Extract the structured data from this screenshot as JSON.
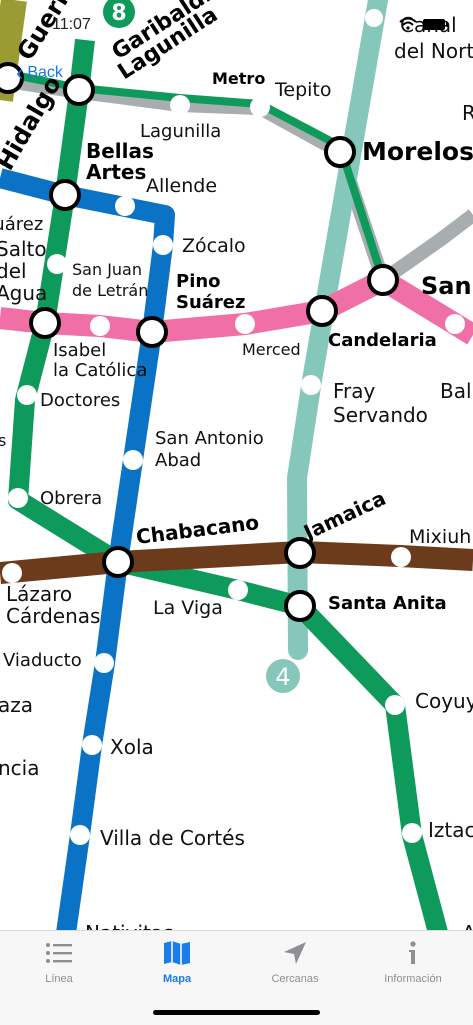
{
  "status_bar": {
    "time": "11:07",
    "back_label": "Back"
  },
  "line_badges": {
    "line8": "8",
    "line4": "4"
  },
  "stations": {
    "guerrero": "Guerrero",
    "garibaldi": "Garibaldi",
    "lagunilla_top": "Lagunilla",
    "hidalgo": "Hidalgo",
    "bellas": "Bellas",
    "artes": "Artes",
    "allende": "Allende",
    "metro": "Metro",
    "tepito": "Tepito",
    "lagunilla": "Lagunilla",
    "morelos": "Morelos",
    "canal": "Canal",
    "del_norte": "del Norte",
    "r": "R",
    "juarez": "Juárez",
    "salto": "Salto",
    "del": "del",
    "agua": "Agua",
    "san_juan": "San Juan",
    "de_letran": "de Letrán",
    "zocalo": "Zócalo",
    "pino": "Pino",
    "suarez": "Suárez",
    "san": "San",
    "candelaria": "Candelaria",
    "merced": "Merced",
    "isabel": "Isabel",
    "la_catolica": "la Católica",
    "fray": "Fray",
    "servando": "Servando",
    "bal": "Bal",
    "doctores": "Doctores",
    "s": "s",
    "san_antonio": "San Antonio",
    "abad": "Abad",
    "obrera": "Obrera",
    "chabacano": "Chabacano",
    "jamaica": "Jamaica",
    "mixiuhca": "Mixiuh",
    "lazaro": "Lázaro",
    "cardenas": "Cárdenas",
    "la_viga": "La Viga",
    "santa_anita": "Santa Anita",
    "viaducto": "Viaducto",
    "coyuya": "Coyuy",
    "aza": "aza",
    "xola": "Xola",
    "ncia": "ncia",
    "iztacalco": "Iztac",
    "villa_de_cortes": "Villa de Cortés",
    "nativitas": "Nativitas",
    "a": "A"
  },
  "colors": {
    "line1": "#f06fa6",
    "line2": "#0b73c5",
    "line4": "#86c7bb",
    "line8": "#0d9a5a",
    "line9": "#6b3b1c",
    "lineB": "#a8adb0",
    "line3": "#9a9b32",
    "accent": "#1a7de8"
  },
  "tabs": [
    {
      "label": "Línea",
      "icon": "list-icon",
      "active": false
    },
    {
      "label": "Mapa",
      "icon": "map-icon",
      "active": true
    },
    {
      "label": "Cercanas",
      "icon": "location-arrow-icon",
      "active": false
    },
    {
      "label": "Información",
      "icon": "info-icon",
      "active": false
    }
  ]
}
